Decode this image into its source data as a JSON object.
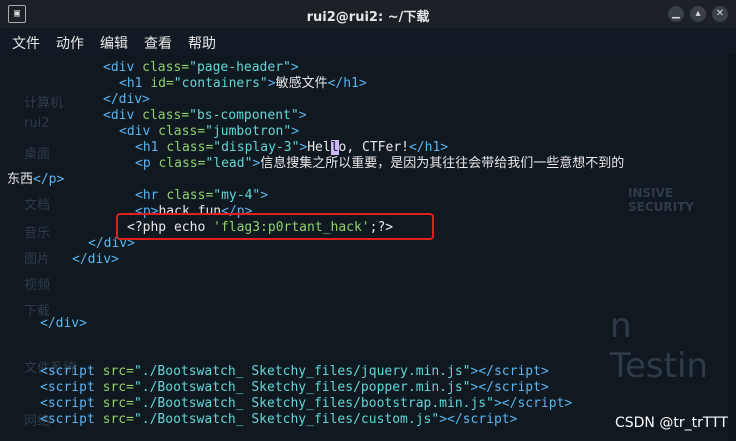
{
  "window": {
    "title": "rui2@rui2: ~/下载"
  },
  "menu": [
    "文件",
    "动作",
    "编辑",
    "查看",
    "帮助"
  ],
  "code": {
    "l1": {
      "attr": "class",
      "val": "page-header"
    },
    "l2": {
      "id": "containers",
      "text": "敏感文件"
    },
    "l4": {
      "val": "bs-component"
    },
    "l5": {
      "val": "jumbotron"
    },
    "l6": {
      "val": "display-3",
      "before": "Hel",
      "cur": "l",
      "after": "o, CTFer!"
    },
    "l7": {
      "val": "lead",
      "text": "信息搜集之所以重要，是因为其往往会带给我们一些意想不到的"
    },
    "l8": {
      "text": "东西"
    },
    "l10": {
      "val": "my-4"
    },
    "l11": {
      "text": "hack fun"
    },
    "l12": {
      "pre": "<?php echo ",
      "str": "'flag3:p0rtant_hack'",
      "post": ";?>"
    },
    "scripts": [
      "./Bootswatch_ Sketchy_files/jquery.min.js",
      "./Bootswatch_ Sketchy_files/popper.min.js",
      "./Bootswatch_ Sketchy_files/bootstrap.min.js",
      "./Bootswatch_ Sketchy_files/custom.js"
    ]
  },
  "background_text": [
    "计算机",
    "rui2",
    "桌面",
    "文档",
    "音乐",
    "图片",
    "视频",
    "下载",
    "文件系统",
    "网络",
    "INSIVE SECURITY",
    "n Testin"
  ],
  "watermark": "CSDN @tr_trTTT"
}
